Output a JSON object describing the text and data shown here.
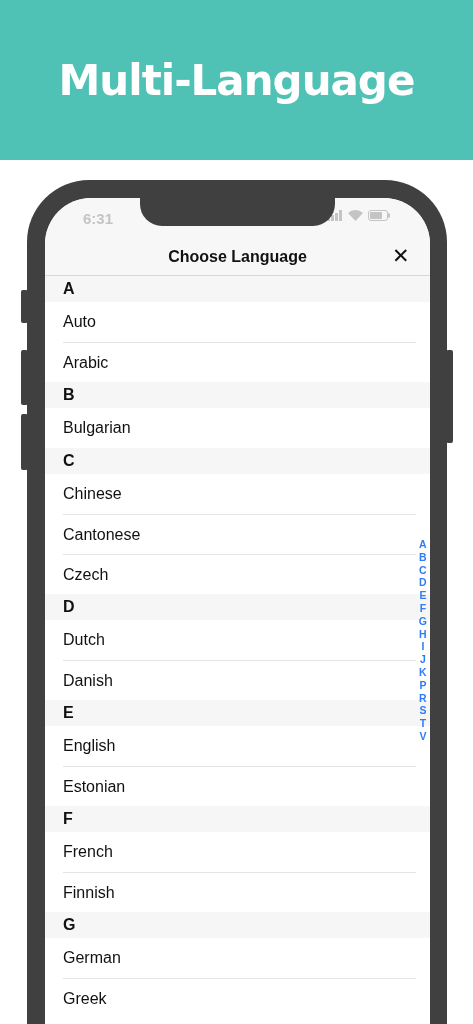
{
  "banner": {
    "title": "Multi-Language"
  },
  "status_bar": {
    "time": "6:31"
  },
  "nav": {
    "title": "Choose Language",
    "close": "✕"
  },
  "sections": [
    {
      "letter": "A",
      "items": [
        "Auto",
        "Arabic"
      ]
    },
    {
      "letter": "B",
      "items": [
        "Bulgarian"
      ]
    },
    {
      "letter": "C",
      "items": [
        "Chinese",
        "Cantonese",
        "Czech"
      ]
    },
    {
      "letter": "D",
      "items": [
        "Dutch",
        "Danish"
      ]
    },
    {
      "letter": "E",
      "items": [
        "English",
        "Estonian"
      ]
    },
    {
      "letter": "F",
      "items": [
        "French",
        "Finnish"
      ]
    },
    {
      "letter": "G",
      "items": [
        "German",
        "Greek"
      ]
    }
  ],
  "index": [
    "A",
    "B",
    "C",
    "D",
    "E",
    "F",
    "G",
    "H",
    "I",
    "J",
    "K",
    "P",
    "R",
    "S",
    "T",
    "V"
  ]
}
